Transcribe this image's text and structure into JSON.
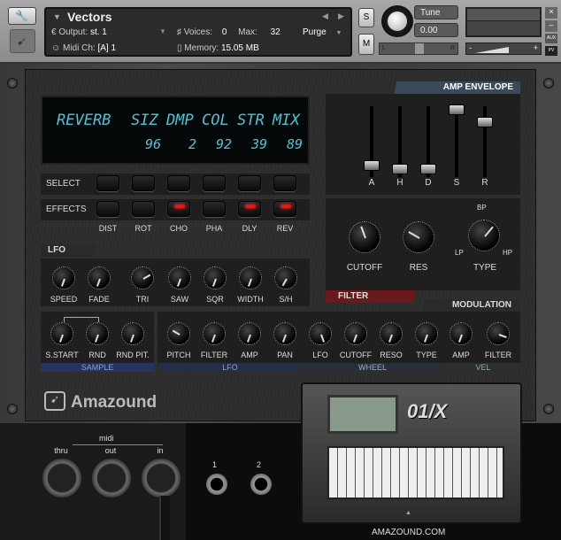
{
  "header": {
    "instrument_name": "Vectors",
    "output_label": "Output:",
    "output_value": "st. 1",
    "midi_label": "Midi Ch:",
    "midi_value": "[A] 1",
    "voices_label": "Voices:",
    "voices_value": "0",
    "max_label": "Max:",
    "max_value": "32",
    "memory_label": "Memory:",
    "memory_value": "15.05 MB",
    "purge_label": "Purge",
    "solo": "S",
    "mute": "M",
    "tune_label": "Tune",
    "tune_value": "0.00",
    "pan_left": "L",
    "pan_right": "R",
    "vol_minus": "-",
    "vol_plus": "+",
    "close": "×",
    "minimize": "–",
    "aux": "AUX",
    "pv": "PV"
  },
  "display": {
    "effect": "REVERB",
    "params": [
      {
        "name": "SIZ",
        "value": "96"
      },
      {
        "name": "DMP",
        "value": "2"
      },
      {
        "name": "COL",
        "value": "92"
      },
      {
        "name": "STR",
        "value": "39"
      },
      {
        "name": "MIX",
        "value": "89"
      }
    ]
  },
  "effects": {
    "select_label": "SELECT",
    "effects_label": "EFFECTS",
    "items": [
      {
        "name": "DIST",
        "on": false
      },
      {
        "name": "ROT",
        "on": false
      },
      {
        "name": "CHO",
        "on": true
      },
      {
        "name": "PHA",
        "on": false
      },
      {
        "name": "DLY",
        "on": true
      },
      {
        "name": "REV",
        "on": true
      }
    ]
  },
  "amp_envelope": {
    "title": "AMP ENVELOPE",
    "faders": [
      {
        "name": "A",
        "value": 0.1
      },
      {
        "name": "H",
        "value": 0.05
      },
      {
        "name": "D",
        "value": 0.05
      },
      {
        "name": "S",
        "value": 1.0
      },
      {
        "name": "R",
        "value": 0.8
      }
    ]
  },
  "filter": {
    "title": "FILTER",
    "cutoff": "CUTOFF",
    "res": "RES",
    "type": "TYPE",
    "type_bp": "BP",
    "type_lp": "LP",
    "type_hp": "HP"
  },
  "lfo": {
    "title": "LFO",
    "knobs": [
      "SPEED",
      "FADE",
      "TRI",
      "SAW",
      "SQR",
      "WIDTH",
      "S/H"
    ]
  },
  "modulation": {
    "title": "MODULATION",
    "sample_knobs": [
      "S.START",
      "RND",
      "RND PIT."
    ],
    "lfo_knobs": [
      "PITCH",
      "FILTER",
      "AMP",
      "PAN"
    ],
    "wheel_knobs": [
      "LFO",
      "CUTOFF",
      "RESO",
      "TYPE"
    ],
    "vel_knobs": [
      "AMP",
      "FILTER"
    ],
    "groups": [
      "SAMPLE",
      "LFO",
      "WHEEL",
      "VEL"
    ]
  },
  "brand": {
    "logo": "Amazound",
    "synth_model": "01/X",
    "website": "AMAZOUND.COM"
  },
  "midi": {
    "title": "midi",
    "ports": [
      "thru",
      "out",
      "in"
    ],
    "outputs": [
      "1",
      "2"
    ]
  },
  "colors": {
    "display_text": "#4cc3d6",
    "led_on": "#e01818",
    "sample_bar": "#2a3a6a"
  }
}
